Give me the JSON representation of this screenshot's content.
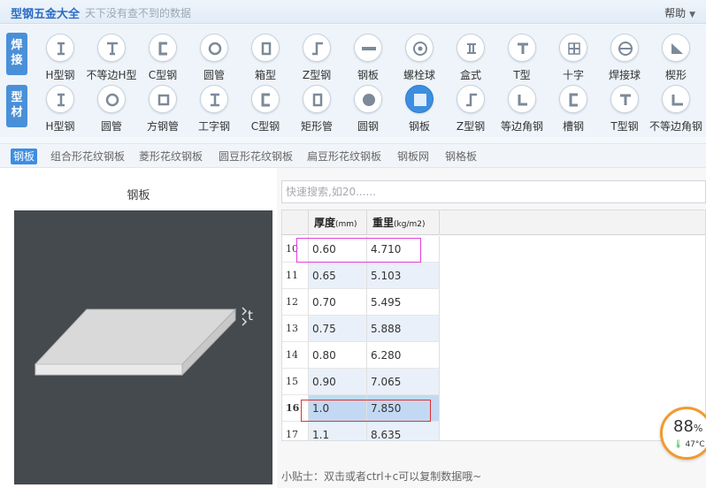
{
  "window": {
    "title": "型钢五金大全",
    "slogan": "天下没有查不到的数据",
    "help": "帮助"
  },
  "categories": {
    "row1_tag": [
      "焊",
      "接"
    ],
    "row2_tag": [
      "型",
      "材"
    ],
    "row1": [
      {
        "label": "H型钢",
        "icon": "h-beam-icon"
      },
      {
        "label": "不等边H型",
        "icon": "unequal-h-beam-icon"
      },
      {
        "label": "C型钢",
        "icon": "c-channel-icon"
      },
      {
        "label": "圆管",
        "icon": "round-pipe-icon"
      },
      {
        "label": "箱型",
        "icon": "box-section-icon"
      },
      {
        "label": "Z型钢",
        "icon": "z-section-icon"
      },
      {
        "label": "钢板",
        "icon": "steel-plate-icon"
      },
      {
        "label": "螺栓球",
        "icon": "bolt-ball-icon"
      },
      {
        "label": "盒式",
        "icon": "box-type-icon"
      },
      {
        "label": "T型",
        "icon": "t-section-icon"
      },
      {
        "label": "十字",
        "icon": "cross-section-icon"
      },
      {
        "label": "焊接球",
        "icon": "welded-ball-icon"
      },
      {
        "label": "楔形",
        "icon": "wedge-icon"
      }
    ],
    "row2": [
      {
        "label": "H型钢",
        "icon": "h-beam-icon"
      },
      {
        "label": "圆管",
        "icon": "round-pipe-icon"
      },
      {
        "label": "方钢管",
        "icon": "square-tube-icon"
      },
      {
        "label": "工字钢",
        "icon": "i-beam-icon"
      },
      {
        "label": "C型钢",
        "icon": "c-channel-icon"
      },
      {
        "label": "矩形管",
        "icon": "rect-tube-icon"
      },
      {
        "label": "圆钢",
        "icon": "round-bar-icon"
      },
      {
        "label": "钢板",
        "icon": "steel-plate-icon",
        "selected": true
      },
      {
        "label": "Z型钢",
        "icon": "z-section-icon"
      },
      {
        "label": "等边角钢",
        "icon": "equal-angle-icon"
      },
      {
        "label": "槽钢",
        "icon": "channel-icon"
      },
      {
        "label": "T型钢",
        "icon": "t-section-icon"
      },
      {
        "label": "不等边角钢",
        "icon": "unequal-angle-icon"
      }
    ]
  },
  "subtabs": [
    "钢板",
    "组合形花纹钢板",
    "菱形花纹钢板",
    "圆豆形花纹钢板",
    "扁豆形花纹钢板",
    "钢板网",
    "钢格板"
  ],
  "left": {
    "title": "钢板",
    "dim_label": "t"
  },
  "search": {
    "placeholder": "快速搜索,如20......"
  },
  "table": {
    "headers": [
      "厚度",
      "重里"
    ],
    "header_units": [
      "(mm)",
      "(kg/m2)"
    ],
    "rows": [
      {
        "n": "10",
        "t": "0.60",
        "w": "4.710"
      },
      {
        "n": "11",
        "t": "0.65",
        "w": "5.103"
      },
      {
        "n": "12",
        "t": "0.70",
        "w": "5.495"
      },
      {
        "n": "13",
        "t": "0.75",
        "w": "5.888"
      },
      {
        "n": "14",
        "t": "0.80",
        "w": "6.280"
      },
      {
        "n": "15",
        "t": "0.90",
        "w": "7.065"
      },
      {
        "n": "16",
        "t": "1.0",
        "w": "7.850"
      },
      {
        "n": "17",
        "t": "1.1",
        "w": "8.635"
      }
    ],
    "selected_row": "16"
  },
  "tip": "小贴士：双击或者ctrl+c可以复制数据哦~",
  "widget": {
    "percent": "88",
    "percent_sign": "%",
    "temp": "47°C"
  },
  "colors": {
    "accent": "#3d8ee0",
    "highlight_pink": "#e040e0",
    "highlight_red": "#e03030"
  }
}
